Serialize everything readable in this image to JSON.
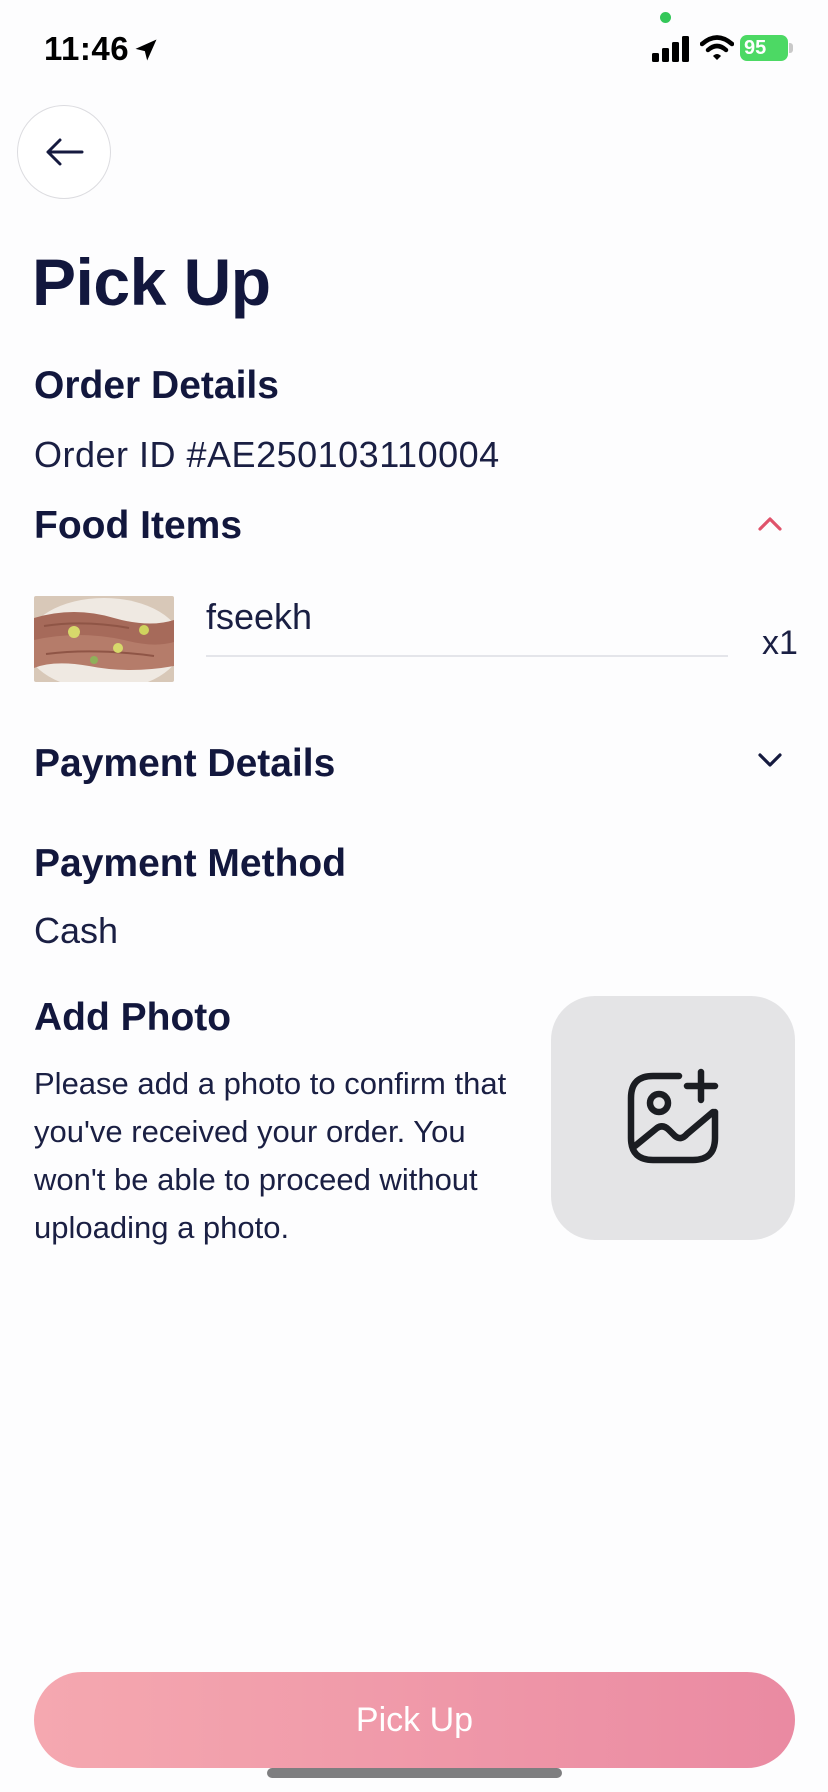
{
  "status_bar": {
    "time": "11:46",
    "battery": "95"
  },
  "header": {
    "title": "Pick Up"
  },
  "order": {
    "heading": "Order Details",
    "order_id": "Order ID #AE250103110004"
  },
  "food": {
    "heading": "Food Items",
    "items": [
      {
        "name": "fseekh",
        "qty": "x1"
      }
    ]
  },
  "payment": {
    "heading": "Payment Details",
    "method_heading": "Payment Method",
    "method_value": "Cash"
  },
  "photo": {
    "heading": "Add Photo",
    "description": "Please add a photo to confirm that you've received your order. You won't be able to proceed without uploading a photo."
  },
  "actions": {
    "pickup_label": "Pick Up"
  },
  "colors": {
    "text_primary": "#12173d",
    "accent_chevron": "#e0536b",
    "button_gradient_start": "#f5a8b0",
    "button_gradient_end": "#ea8aa2"
  },
  "icons": {
    "back": "arrow-left-icon",
    "expand_food": "chevron-up-icon",
    "expand_payment": "chevron-down-icon",
    "add_photo": "image-add-icon"
  }
}
